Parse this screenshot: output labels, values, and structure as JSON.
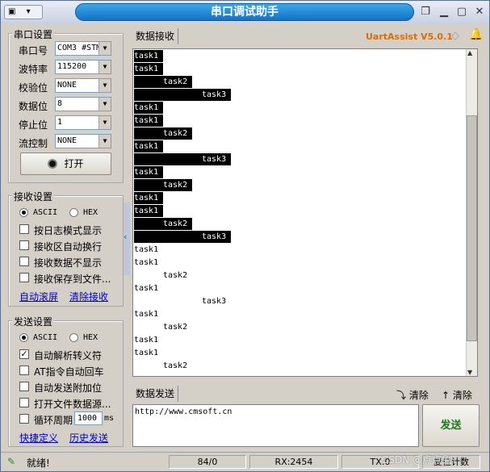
{
  "window": {
    "title": "串口调试助手"
  },
  "serial_settings": {
    "title": "串口设置",
    "port": {
      "label": "串口号",
      "value": "COM3 #STM"
    },
    "baud": {
      "label": "波特率",
      "value": "115200"
    },
    "parity": {
      "label": "校验位",
      "value": "NONE"
    },
    "databits": {
      "label": "数据位",
      "value": "8"
    },
    "stopbits": {
      "label": "停止位",
      "value": "1"
    },
    "flow": {
      "label": "流控制",
      "value": "NONE"
    },
    "open_label": "打开"
  },
  "receive_settings": {
    "title": "接收设置",
    "ascii": "ASCII",
    "hex": "HEX",
    "log_mode": "按日志模式显示",
    "auto_wrap": "接收区自动换行",
    "hide_data": "接收数据不显示",
    "save_file": "接收保存到文件...",
    "auto_scroll": "自动滚屏",
    "clear_recv": "清除接收"
  },
  "send_settings": {
    "title": "发送设置",
    "ascii": "ASCII",
    "hex": "HEX",
    "auto_escape": "自动解析转义符",
    "at_cr": "AT指令自动回车",
    "auto_append": "自动发送附加位",
    "open_file": "打开文件数据源...",
    "cycle": "循环周期",
    "cycle_value": "1000",
    "cycle_unit": "ms",
    "quick_def": "快捷定义",
    "history": "历史发送"
  },
  "receive_panel": {
    "tab": "数据接收",
    "brand": "UartAssist V5.0.1",
    "lines": [
      {
        "text": "task1",
        "indent": 0,
        "hl": true
      },
      {
        "text": "task1",
        "indent": 0,
        "hl": true
      },
      {
        "text": "task2",
        "indent": 1,
        "hl": true
      },
      {
        "text": "task3",
        "indent": 2,
        "hl": true
      },
      {
        "text": "task1",
        "indent": 0,
        "hl": true
      },
      {
        "text": "task1",
        "indent": 0,
        "hl": true
      },
      {
        "text": "task2",
        "indent": 1,
        "hl": true
      },
      {
        "text": "task1",
        "indent": 0,
        "hl": true
      },
      {
        "text": "task3",
        "indent": 2,
        "hl": true
      },
      {
        "text": "task1",
        "indent": 0,
        "hl": true
      },
      {
        "text": "task2",
        "indent": 1,
        "hl": true
      },
      {
        "text": "task1",
        "indent": 0,
        "hl": true
      },
      {
        "text": "task1",
        "indent": 0,
        "hl": true
      },
      {
        "text": "task2",
        "indent": 1,
        "hl": true
      },
      {
        "text": "task3",
        "indent": 2,
        "hl": true
      },
      {
        "text": "task1",
        "indent": 0,
        "hl": false
      },
      {
        "text": "task1",
        "indent": 0,
        "hl": false
      },
      {
        "text": "task2",
        "indent": 1,
        "hl": false
      },
      {
        "text": "task1",
        "indent": 0,
        "hl": false
      },
      {
        "text": "task3",
        "indent": 2,
        "hl": false
      },
      {
        "text": "task1",
        "indent": 0,
        "hl": false
      },
      {
        "text": "task2",
        "indent": 1,
        "hl": false
      },
      {
        "text": "task1",
        "indent": 0,
        "hl": false
      },
      {
        "text": "task1",
        "indent": 0,
        "hl": false
      },
      {
        "text": "task2",
        "indent": 1,
        "hl": false
      }
    ]
  },
  "send_panel": {
    "tab": "数据发送",
    "clear1": "清除",
    "clear2": "清除",
    "input": "http://www.cmsoft.cn",
    "send": "发送"
  },
  "status": {
    "ready": "就绪!",
    "tx_count": "84/0",
    "rx": "RX:2454",
    "tx": "TX:0",
    "reset": "复位计数"
  },
  "watermark": "CSDN @点点兔"
}
